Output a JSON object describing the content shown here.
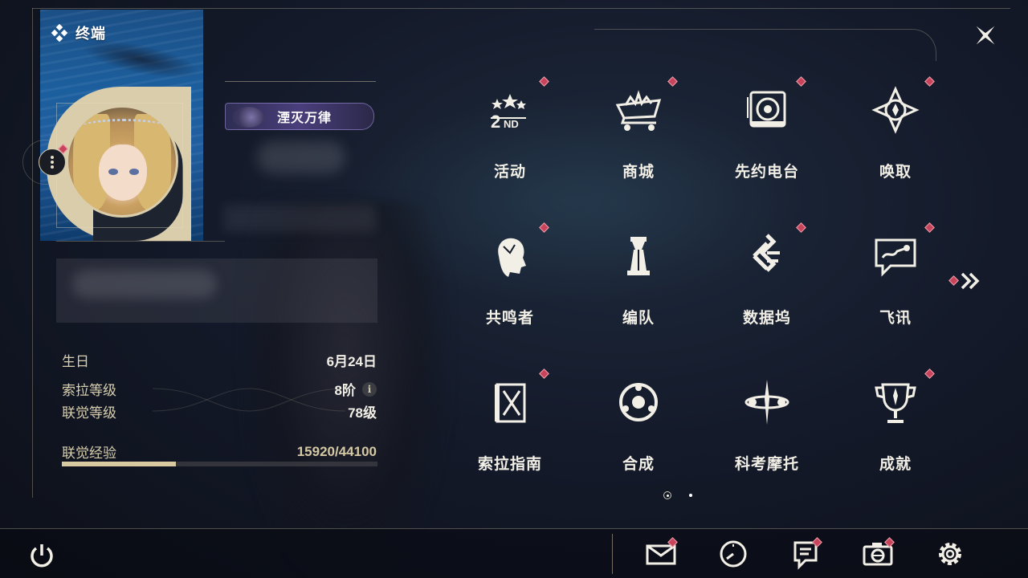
{
  "header": {
    "title": "终端",
    "title_icon": "terminal-diamond-icon",
    "close_icon": "close-star-icon"
  },
  "profile": {
    "avatar": "character-avatar-blonde",
    "more_icon": "more-vertical-icon",
    "badge_title": "湮灭万律"
  },
  "stats": {
    "birthday_label": "生日",
    "birthday_value": "6月24日",
    "sola_level_label": "索拉等级",
    "sola_level_value": "8阶",
    "info_icon": "i",
    "sync_level_label": "联觉等级",
    "sync_level_value": "78级",
    "exp_label": "联觉经验",
    "exp_value": "15920/44100",
    "exp_current": 15920,
    "exp_max": 44100
  },
  "grid": {
    "items": [
      {
        "label": "活动",
        "icon": "event-2nd-anniversary-icon",
        "badge": true
      },
      {
        "label": "商城",
        "icon": "shop-cart-icon",
        "badge": true
      },
      {
        "label": "先约电台",
        "icon": "radio-speaker-icon",
        "badge": true
      },
      {
        "label": "唤取",
        "icon": "gacha-compass-icon",
        "badge": true
      },
      {
        "label": "共鸣者",
        "icon": "resonator-head-icon",
        "badge": true
      },
      {
        "label": "编队",
        "icon": "team-chess-icon",
        "badge": false
      },
      {
        "label": "数据坞",
        "icon": "data-dock-icon",
        "badge": true
      },
      {
        "label": "飞讯",
        "icon": "message-chat-icon",
        "badge": true
      },
      {
        "label": "索拉指南",
        "icon": "guide-book-icon",
        "badge": true
      },
      {
        "label": "合成",
        "icon": "synthesis-circle-icon",
        "badge": false
      },
      {
        "label": "科考摩托",
        "icon": "motorbike-icon",
        "badge": false
      },
      {
        "label": "成就",
        "icon": "achievement-trophy-icon",
        "badge": true
      }
    ],
    "next_icon": "double-chevron-right-icon"
  },
  "bottom_bar": {
    "power_icon": "power-icon",
    "buttons": [
      {
        "name": "mail",
        "icon": "mail-icon",
        "badge": true
      },
      {
        "name": "clock",
        "icon": "clock-icon",
        "badge": false
      },
      {
        "name": "notice",
        "icon": "notice-document-icon",
        "badge": true
      },
      {
        "name": "camera",
        "icon": "camera-icon",
        "badge": true
      },
      {
        "name": "settings",
        "icon": "settings-gear-icon",
        "badge": false
      }
    ]
  },
  "colors": {
    "accent_beige": "#d9cdab",
    "badge_red": "#c8445a",
    "text_gold": "#d8cfae",
    "background": "#141a2a"
  },
  "pagination": {
    "pages": 2,
    "current": 1
  }
}
